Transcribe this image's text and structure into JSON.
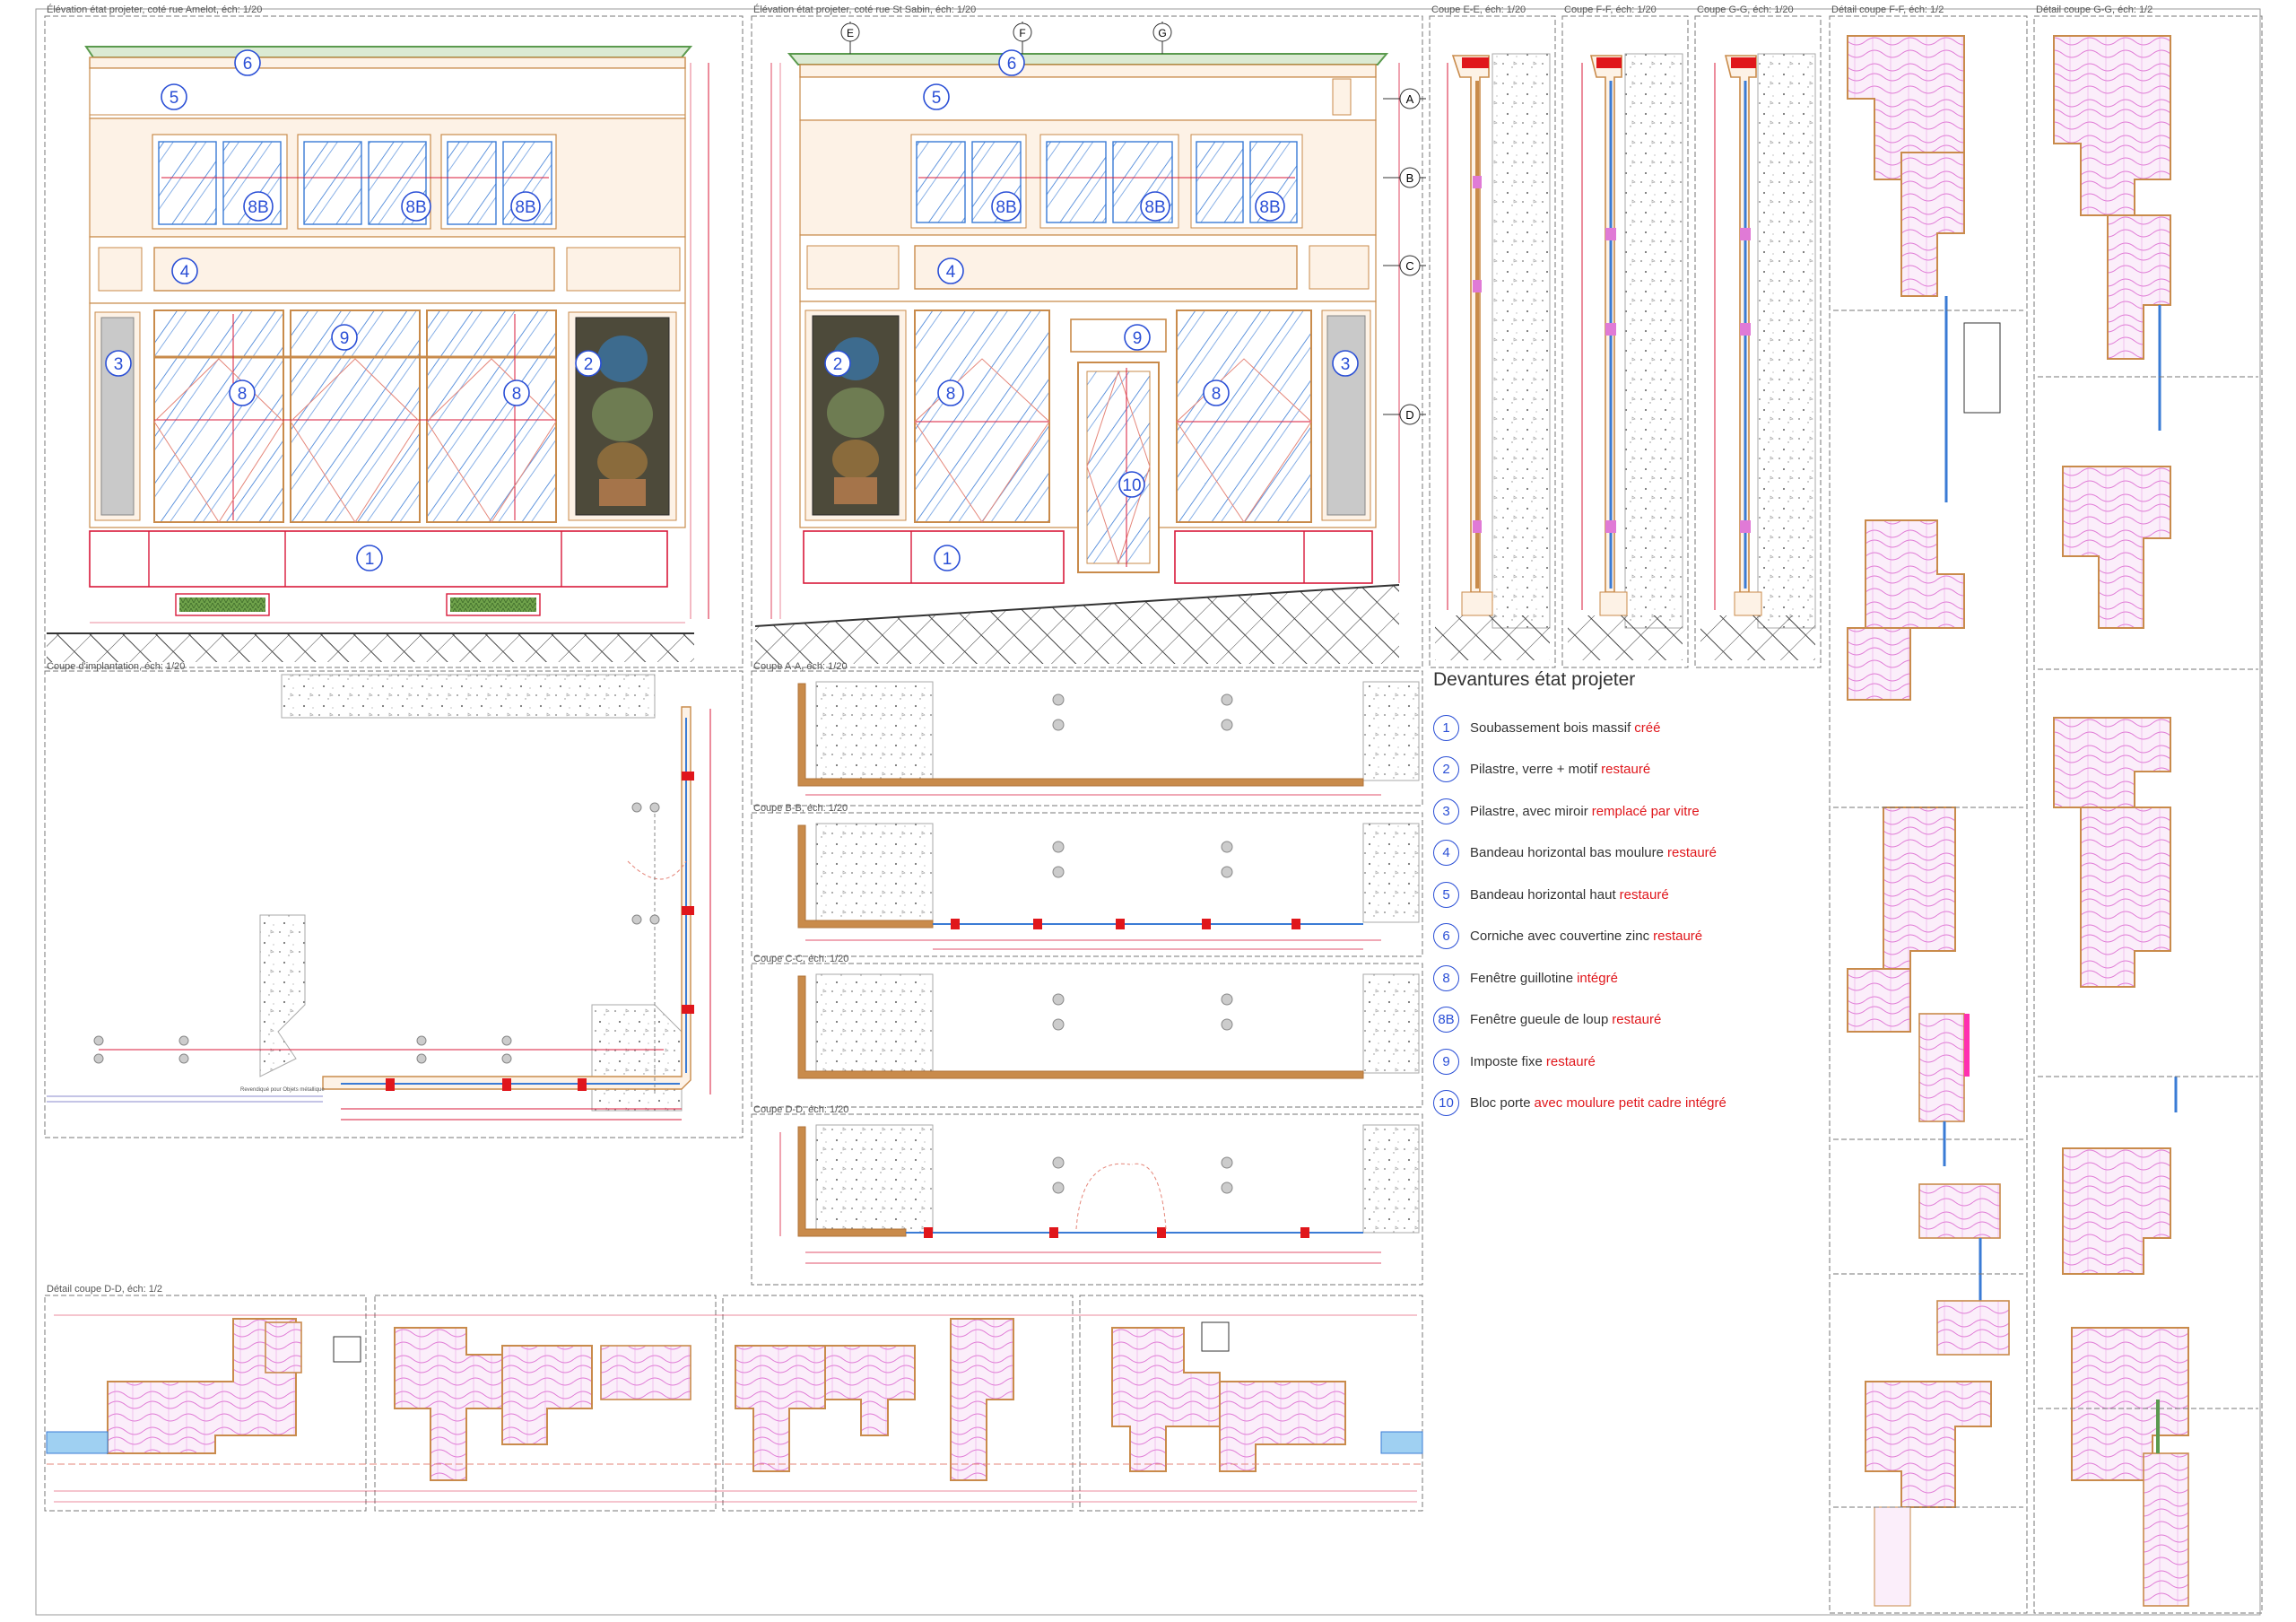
{
  "panels": {
    "elev_amelot": "Élévation état projeter, coté rue Amelot, éch: 1/20",
    "elev_sabin": "Élévation état projeter, coté rue St Sabin, éch: 1/20",
    "coupe_ee": "Coupe E-E, éch: 1/20",
    "coupe_ff": "Coupe F-F, éch: 1/20",
    "coupe_gg": "Coupe G-G, éch: 1/20",
    "detail_ff": "Détail coupe F-F, éch: 1/2",
    "detail_gg": "Détail coupe G-G, éch: 1/2",
    "implantation": "Coupe d'implantation, éch: 1/20",
    "coupe_aa": "Coupe A-A, éch: 1/20",
    "coupe_bb": "Coupe B-B, éch: 1/20",
    "coupe_cc": "Coupe C-C, éch: 1/20",
    "coupe_dd": "Coupe D-D, éch: 1/20",
    "detail_dd": "Détail coupe D-D, éch: 1/2"
  },
  "section_marks": [
    "A",
    "B",
    "C",
    "D"
  ],
  "top_marks": [
    "E",
    "F",
    "G"
  ],
  "bubbles": [
    "1",
    "2",
    "3",
    "4",
    "5",
    "6",
    "8",
    "8B",
    "9",
    "10"
  ],
  "implantation_note": "Revendiqué pour Objets métallique",
  "legend": {
    "title": "Devantures état projeter",
    "items": [
      {
        "num": "1",
        "text": "Soubassement bois massif",
        "status": "créé"
      },
      {
        "num": "2",
        "text": "Pilastre, verre + motif",
        "status": "restauré"
      },
      {
        "num": "3",
        "text": "Pilastre, avec miroir",
        "status": "remplacé par vitre"
      },
      {
        "num": "4",
        "text": "Bandeau horizontal bas moulure",
        "status": "restauré"
      },
      {
        "num": "5",
        "text": "Bandeau horizontal haut",
        "status": "restauré"
      },
      {
        "num": "6",
        "text": "Corniche avec couvertine zinc",
        "status": "restauré"
      },
      {
        "num": "8",
        "text": "Fenêtre guillotine",
        "status": "intégré"
      },
      {
        "num": "8B",
        "text": "Fenêtre gueule de loup",
        "status": "restauré"
      },
      {
        "num": "9",
        "text": "Imposte fixe",
        "status": "restauré"
      },
      {
        "num": "10",
        "text": "Bloc porte",
        "status": "avec moulure petit cadre intégré"
      }
    ]
  },
  "colors": {
    "wood": "#c98b4b",
    "wood_fill": "#fdf2e6",
    "glass": "#3a7bd5",
    "dimension": "#d8193a",
    "bubble": "#2a4fd6",
    "cornice": "#5a9a4e",
    "mirror": "#c9c9c9",
    "hatch": "#e07ad6",
    "frame": "#777777"
  }
}
